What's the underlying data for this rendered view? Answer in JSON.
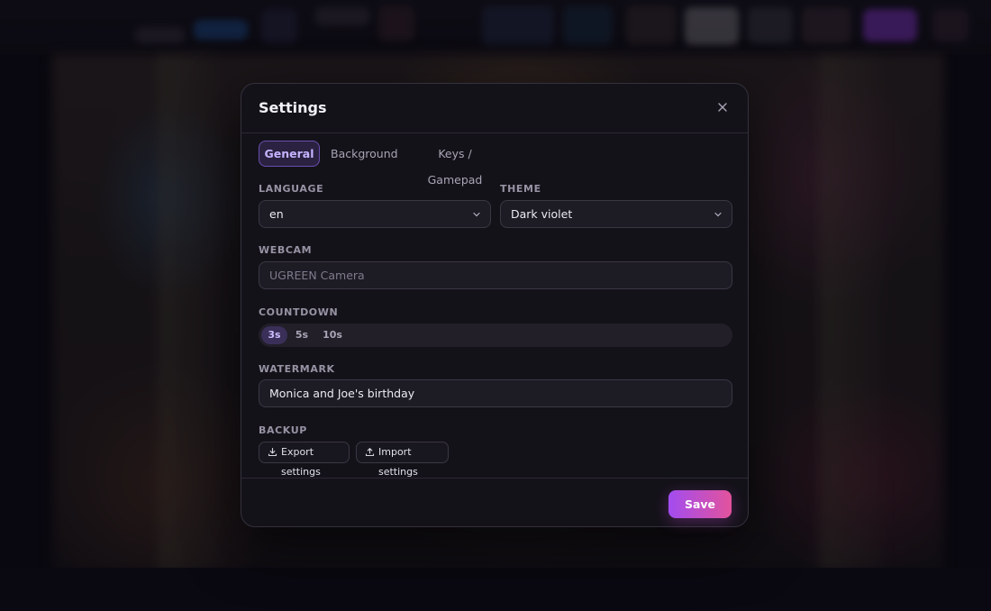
{
  "colors": {
    "accent_start": "#a24cf0",
    "accent_end": "#e2539c",
    "active_tab_text": "#c6b3ff",
    "modal_bg": "#141219"
  },
  "dialog": {
    "title": "Settings",
    "close_icon": "close-icon"
  },
  "tabs": [
    {
      "label": "General",
      "active": true
    },
    {
      "label": "Background",
      "active": false
    },
    {
      "label": "Keys / Gamepad",
      "active": false
    }
  ],
  "language": {
    "label": "LANGUAGE",
    "value": "en",
    "icon": "chevron-down-icon"
  },
  "theme": {
    "label": "THEME",
    "value": "Dark violet",
    "icon": "chevron-down-icon"
  },
  "webcam": {
    "label": "WEBCAM",
    "placeholder": "UGREEN Camera"
  },
  "countdown": {
    "label": "COUNTDOWN",
    "options": [
      "3s",
      "5s",
      "10s"
    ],
    "selected": "3s"
  },
  "watermark": {
    "label": "WATERMARK",
    "value": "Monica and Joe's birthday"
  },
  "backup": {
    "label": "BACKUP",
    "export_label": "Export settings",
    "export_icon": "download-icon",
    "import_label": "Import settings",
    "import_icon": "upload-icon"
  },
  "footer": {
    "save_label": "Save"
  }
}
